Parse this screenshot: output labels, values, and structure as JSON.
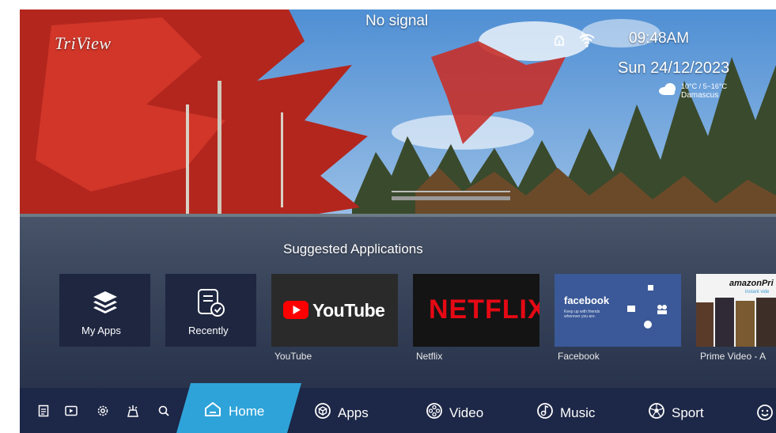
{
  "brand": {
    "logo_text": "TriView"
  },
  "status": {
    "signal": "No signal",
    "time": "09:48AM",
    "date": "Sun 24/12/2023",
    "weather": {
      "temp": "10°C / 5~16°C",
      "city": "Damascus",
      "icon": "cloud-icon"
    },
    "icons": [
      "ethernet-icon",
      "wifi-icon"
    ]
  },
  "suggested": {
    "title": "Suggested Applications",
    "tiles": [
      {
        "label": "My Apps",
        "icon": "layers-icon"
      },
      {
        "label": "Recently",
        "icon": "recent-icon"
      }
    ],
    "apps": [
      {
        "caption": "YouTube",
        "logo": "YouTube"
      },
      {
        "caption": "Netflix",
        "logo": "NETFLIX"
      },
      {
        "caption": "Facebook",
        "logo": "facebook",
        "tagline": "Keep up with friends wherever you are."
      },
      {
        "caption": "Prime Video - A",
        "logo": "amazonPri",
        "tagline": "instant vide"
      }
    ]
  },
  "nav": {
    "quick_icons": [
      "notes-icon",
      "input-source-icon",
      "settings-icon",
      "cleaner-icon",
      "search-icon"
    ],
    "items": [
      {
        "label": "Home",
        "icon": "home-icon",
        "active": true
      },
      {
        "label": "Apps",
        "icon": "apps-icon"
      },
      {
        "label": "Video",
        "icon": "video-icon"
      },
      {
        "label": "Music",
        "icon": "music-icon"
      },
      {
        "label": "Sport",
        "icon": "sport-icon"
      }
    ],
    "more_icon": "smiley-icon"
  },
  "colors": {
    "navbar": "#1d2747",
    "home_tab": "#2ea3d9",
    "youtube_red": "#ff0000",
    "netflix_red": "#e50914",
    "facebook_blue": "#3b5998"
  }
}
